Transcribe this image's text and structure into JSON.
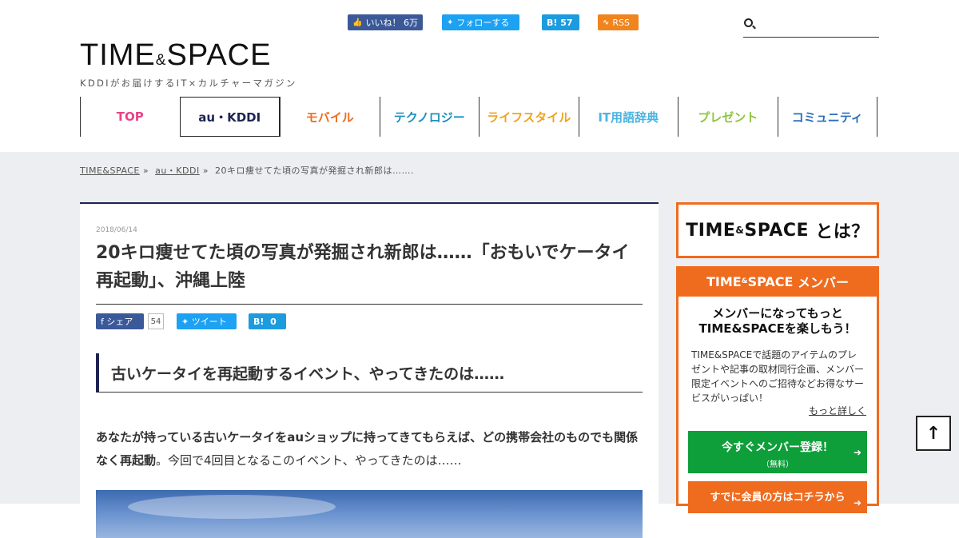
{
  "social": {
    "facebook_label": "いいね！",
    "facebook_count": "6万",
    "twitter_label": "フォローする",
    "hatena_label": "B!",
    "hatena_count": "57",
    "rss_label": "RSS"
  },
  "search": {
    "placeholder": ""
  },
  "logo": {
    "title": "TIME",
    "amp": "&",
    "title2": "SPACE",
    "tagline": "KDDIがお届けするIT×カルチャーマガジン"
  },
  "nav": [
    {
      "label": "TOP",
      "color": "#e8438a"
    },
    {
      "label": "au・KDDI",
      "color": "#1e2452"
    },
    {
      "label": "モバイル",
      "color": "#ef6b1e"
    },
    {
      "label": "テクノロジー",
      "color": "#1e8fbf"
    },
    {
      "label": "ライフスタイル",
      "color": "#f0a21e"
    },
    {
      "label": "IT用語辞典",
      "color": "#4bb3e0"
    },
    {
      "label": "プレゼント",
      "color": "#8cc63f"
    },
    {
      "label": "コミュニティ",
      "color": "#2a6fb8"
    }
  ],
  "breadcrumb": {
    "home": "TIME&SPACE",
    "sep": "»",
    "category": "au・KDDI",
    "current": "20キロ痩せてた頃の写真が発掘され新郎は……."
  },
  "article": {
    "date": "2018/06/14",
    "title": "20キロ痩せてた頃の写真が発掘され新郎は……「おもいでケータイ再起動」、沖縄上陸",
    "share_fb": "シェア",
    "share_fb_count": "54",
    "share_tw": "ツイート",
    "share_hb": "B!",
    "share_hb_count": "0",
    "heading": "古いケータイを再起動するイベント、やってきたのは……",
    "lead_bold": "あなたが持っている古いケータイをauショップに持ってきてもらえば、どの携帯会社のものでも関係なく再起動",
    "lead_rest": "。今回で4回目となるこのイベント、やってきたのは……"
  },
  "sidebar": {
    "about_title": "TIME",
    "about_amp": "&",
    "about_title2": "SPACE",
    "about_suffix": "とは？",
    "member_head": "TIME",
    "member_head_amp": "&",
    "member_head2": "SPACE",
    "member_head_suffix": "メンバー",
    "member_headline_1": "メンバーになってもっと",
    "member_headline_2": "TIME&SPACEを楽しもう！",
    "member_text": "TIME&SPACEで話題のアイテムのプレゼントや記事の取材同行企画、メンバー限定イベントへのご招待などお得なサービスがいっぱい！",
    "more_link": "もっと詳しく",
    "register_label": "今すぐメンバー登録！",
    "register_sub": "（無料）",
    "login_label": "すでに会員の方はコチラから"
  },
  "to_top_icon": "arrow-up-icon"
}
